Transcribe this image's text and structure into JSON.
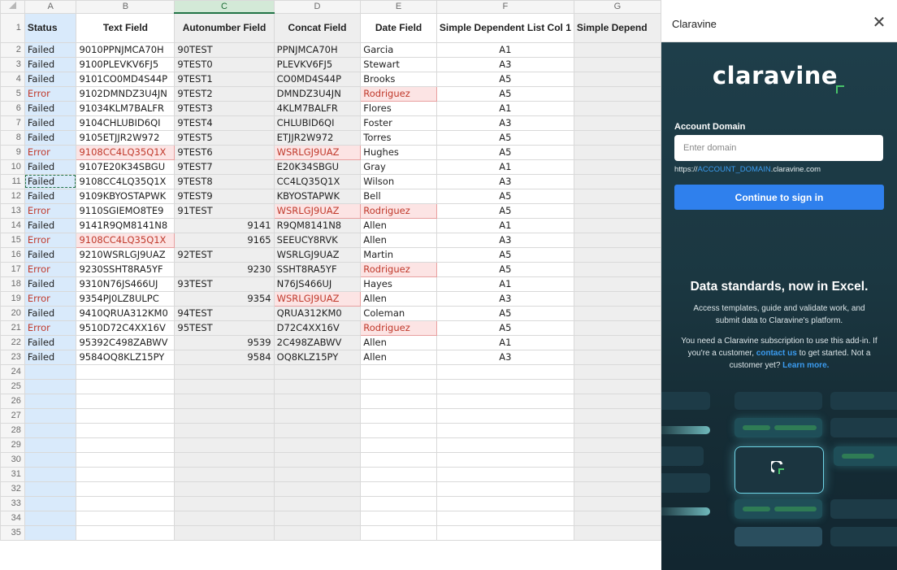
{
  "sheet": {
    "columns": [
      "A",
      "B",
      "C",
      "D",
      "E",
      "F",
      "G"
    ],
    "headers": [
      "Status",
      "Text Field",
      "Autonumber Field",
      "Concat Field",
      "Date Field",
      "Simple Dependent List Col 1",
      "Simple Depend"
    ],
    "rows": [
      {
        "n": "2",
        "status": "Failed",
        "text": "9010PPNJMCA70H",
        "auto": "90TEST",
        "concat": "PPNJMCA70H",
        "date": "Garcia",
        "dep": "A1"
      },
      {
        "n": "3",
        "status": "Failed",
        "text": "9100PLEVKV6FJ5",
        "auto": "9TEST0",
        "concat": "PLEVKV6FJ5",
        "date": "Stewart",
        "dep": "A3"
      },
      {
        "n": "4",
        "status": "Failed",
        "text": "9101CO0MD4S44P",
        "auto": "9TEST1",
        "concat": "CO0MD4S44P",
        "date": "Brooks",
        "dep": "A5"
      },
      {
        "n": "5",
        "status": "Error",
        "text": "9102DMNDZ3U4JN",
        "auto": "9TEST2",
        "concat": "DMNDZ3U4JN",
        "date": "Rodriguez",
        "dep": "A5"
      },
      {
        "n": "6",
        "status": "Failed",
        "text": "91034KLM7BALFR",
        "auto": "9TEST3",
        "concat": "4KLM7BALFR",
        "date": "Flores",
        "dep": "A1"
      },
      {
        "n": "7",
        "status": "Failed",
        "text": "9104CHLUBID6QI",
        "auto": "9TEST4",
        "concat": "CHLUBID6QI",
        "date": "Foster",
        "dep": "A3"
      },
      {
        "n": "8",
        "status": "Failed",
        "text": "9105ETJJR2W972",
        "auto": "9TEST5",
        "concat": "ETJJR2W972",
        "date": "Torres",
        "dep": "A5"
      },
      {
        "n": "9",
        "status": "Error",
        "text": "9108CC4LQ35Q1X",
        "auto": "9TEST6",
        "concat": "WSRLGJ9UAZ",
        "date": "Hughes",
        "dep": "A5"
      },
      {
        "n": "10",
        "status": "Failed",
        "text": "9107E20K34SBGU",
        "auto": "9TEST7",
        "concat": "E20K34SBGU",
        "date": "Gray",
        "dep": "A1"
      },
      {
        "n": "11",
        "status": "Failed",
        "text": "9108CC4LQ35Q1X",
        "auto": "9TEST8",
        "concat": "CC4LQ35Q1X",
        "date": "Wilson",
        "dep": "A3"
      },
      {
        "n": "12",
        "status": "Failed",
        "text": "9109KBYOSTAPWK",
        "auto": "9TEST9",
        "concat": "KBYOSTAPWK",
        "date": "Bell",
        "dep": "A5"
      },
      {
        "n": "13",
        "status": "Error",
        "text": "9110SGIEMO8TE9",
        "auto": "91TEST",
        "concat": "WSRLGJ9UAZ",
        "date": "Rodriguez",
        "dep": "A5"
      },
      {
        "n": "14",
        "status": "Failed",
        "text": "9141R9QM8141N8",
        "auto": "",
        "autonum": "9141",
        "concat": "R9QM8141N8",
        "date": "Allen",
        "dep": "A1"
      },
      {
        "n": "15",
        "status": "Error",
        "text": "9108CC4LQ35Q1X",
        "auto": "",
        "autonum": "9165",
        "concat": "SEEUCY8RVK",
        "date": "Allen",
        "dep": "A3"
      },
      {
        "n": "16",
        "status": "Failed",
        "text": "9210WSRLGJ9UAZ",
        "auto": "92TEST",
        "concat": "WSRLGJ9UAZ",
        "date": "Martin",
        "dep": "A5"
      },
      {
        "n": "17",
        "status": "Error",
        "text": "9230SSHT8RA5YF",
        "auto": "",
        "autonum": "9230",
        "concat": "SSHT8RA5YF",
        "date": "Rodriguez",
        "dep": "A5"
      },
      {
        "n": "18",
        "status": "Failed",
        "text": "9310N76JS466UJ",
        "auto": "93TEST",
        "concat": "N76JS466UJ",
        "date": "Hayes",
        "dep": "A1"
      },
      {
        "n": "19",
        "status": "Error",
        "text": "9354PJ0LZ8ULPC",
        "auto": "",
        "autonum": "9354",
        "concat": "WSRLGJ9UAZ",
        "date": "Allen",
        "dep": "A3"
      },
      {
        "n": "20",
        "status": "Failed",
        "text": "9410QRUA312KM0",
        "auto": "94TEST",
        "concat": "QRUA312KM0",
        "date": "Coleman",
        "dep": "A5"
      },
      {
        "n": "21",
        "status": "Error",
        "text": "9510D72C4XX16V",
        "auto": "95TEST",
        "concat": "D72C4XX16V",
        "date": "Rodriguez",
        "dep": "A5"
      },
      {
        "n": "22",
        "status": "Failed",
        "text": "95392C498ZABWV",
        "auto": "",
        "autonum": "9539",
        "concat": "2C498ZABWV",
        "date": "Allen",
        "dep": "A1"
      },
      {
        "n": "23",
        "status": "Failed",
        "text": "9584OQ8KLZ15PY",
        "auto": "",
        "autonum": "9584",
        "concat": "OQ8KLZ15PY",
        "date": "Allen",
        "dep": "A3"
      }
    ],
    "empty_rows": [
      "24",
      "25",
      "26",
      "27",
      "28",
      "29",
      "30",
      "31",
      "32",
      "33",
      "34",
      "35"
    ],
    "error_cells": {
      "5": [
        "concat_box",
        "date"
      ],
      "9": [
        "text",
        "concat"
      ],
      "13": [
        "concat",
        "date"
      ],
      "15": [
        "text"
      ],
      "17": [
        "date"
      ],
      "19": [
        "concat"
      ],
      "21": [
        "date"
      ]
    }
  },
  "panel": {
    "title": "Claravine",
    "close_icon": "close-icon",
    "logo_text": "claravine",
    "domain_label": "Account Domain",
    "domain_placeholder": "Enter domain",
    "domain_value": "",
    "hint_prefix": "https://",
    "hint_highlight": "ACCOUNT_DOMAIN",
    "hint_suffix": ".claravine.com",
    "continue_label": "Continue to sign in",
    "tagline": "Data standards, now in Excel.",
    "description": "Access templates, guide and validate work, and submit data to Claravine's platform.",
    "note_1": "You need a Claravine subscription to use this add-in. If you're a customer,",
    "contact_link": "contact us",
    "note_2": "to get started. Not a customer yet?",
    "learn_link": "Learn more.",
    "colors": {
      "accent": "#2f80ed",
      "brand_green": "#48c46a",
      "panel_bg": "#1f3a44"
    }
  }
}
